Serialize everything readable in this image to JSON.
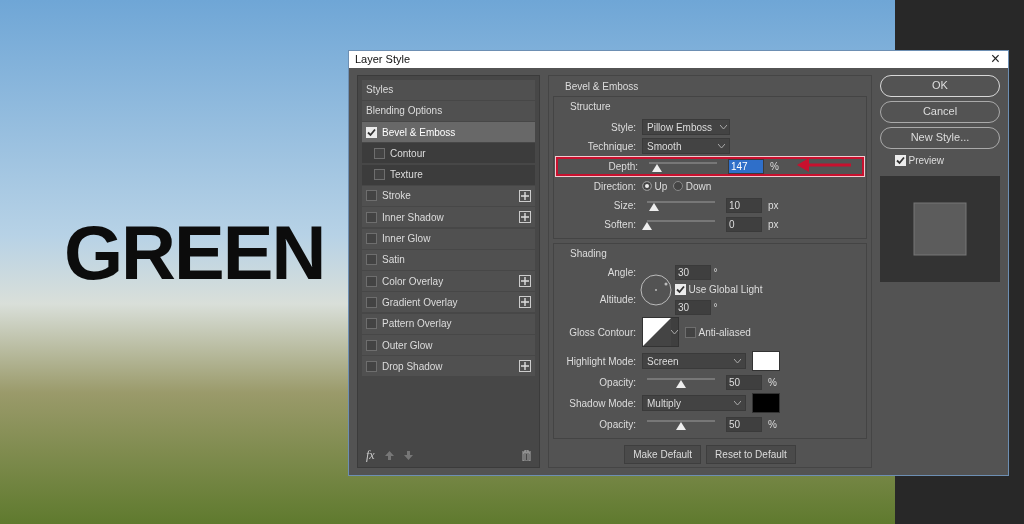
{
  "canvas": {
    "text": "GREEN"
  },
  "window": {
    "title": "Layer Style",
    "close": "×"
  },
  "styles_list": {
    "items": [
      {
        "kind": "header",
        "label": "Styles",
        "selected": false
      },
      {
        "kind": "header",
        "label": "Blending Options",
        "selected": false
      },
      {
        "kind": "effect",
        "label": "Bevel & Emboss",
        "checked": true,
        "selected": true,
        "addable": false,
        "children": [
          {
            "kind": "effect",
            "label": "Contour",
            "checked": false,
            "selected": false,
            "addable": false
          },
          {
            "kind": "effect",
            "label": "Texture",
            "checked": false,
            "selected": false,
            "addable": false
          }
        ]
      },
      {
        "kind": "effect",
        "label": "Stroke",
        "checked": false,
        "selected": false,
        "addable": true
      },
      {
        "kind": "effect",
        "label": "Inner Shadow",
        "checked": false,
        "selected": false,
        "addable": true
      },
      {
        "kind": "effect",
        "label": "Inner Glow",
        "checked": false,
        "selected": false,
        "addable": false
      },
      {
        "kind": "effect",
        "label": "Satin",
        "checked": false,
        "selected": false,
        "addable": false
      },
      {
        "kind": "effect",
        "label": "Color Overlay",
        "checked": false,
        "selected": false,
        "addable": true
      },
      {
        "kind": "effect",
        "label": "Gradient Overlay",
        "checked": false,
        "selected": false,
        "addable": true
      },
      {
        "kind": "effect",
        "label": "Pattern Overlay",
        "checked": false,
        "selected": false,
        "addable": false
      },
      {
        "kind": "effect",
        "label": "Outer Glow",
        "checked": false,
        "selected": false,
        "addable": false
      },
      {
        "kind": "effect",
        "label": "Drop Shadow",
        "checked": false,
        "selected": false,
        "addable": true
      }
    ],
    "fx_label": "fx"
  },
  "panel": {
    "title": "Bevel & Emboss",
    "structure": {
      "title": "Structure",
      "rows": [
        {
          "kind": "select",
          "label": "Style:",
          "value": "Pillow Emboss"
        },
        {
          "kind": "select",
          "label": "Technique:",
          "value": "Smooth"
        },
        {
          "kind": "slider",
          "label": "Depth:",
          "level": 0.12,
          "value": "147",
          "unit": "%",
          "highlighted": true,
          "text_selected": true
        },
        {
          "kind": "radio",
          "label": "Direction:",
          "options": [
            {
              "label": "Up",
              "selected": true
            },
            {
              "label": "Down",
              "selected": false
            }
          ]
        },
        {
          "kind": "slider",
          "label": "Size:",
          "level": 0.1,
          "value": "10",
          "unit": "px",
          "highlighted": false,
          "text_selected": false
        },
        {
          "kind": "slider",
          "label": "Soften:",
          "level": 0,
          "value": "0",
          "unit": "px",
          "highlighted": false,
          "text_selected": false
        }
      ]
    },
    "shading": {
      "title": "Shading",
      "angle": {
        "label": "Angle:",
        "value": "30",
        "unit": "°"
      },
      "global_light": {
        "label": "Use Global Light",
        "checked": true
      },
      "altitude": {
        "label": "Altitude:",
        "value": "30",
        "unit": "°"
      },
      "gloss": {
        "label": "Gloss Contour:",
        "anti_aliased": {
          "label": "Anti-aliased",
          "checked": false
        }
      },
      "rows": [
        {
          "kind": "mode",
          "label": "Highlight Mode:",
          "value": "Screen",
          "color": "#ffffff"
        },
        {
          "kind": "slider",
          "label": "Opacity:",
          "level": 0.5,
          "value": "50",
          "unit": "%",
          "highlighted": false,
          "text_selected": false
        },
        {
          "kind": "mode",
          "label": "Shadow Mode:",
          "value": "Multiply",
          "color": "#000000"
        },
        {
          "kind": "slider",
          "label": "Opacity:",
          "level": 0.5,
          "value": "50",
          "unit": "%",
          "highlighted": false,
          "text_selected": false
        }
      ]
    },
    "buttons": [
      "Make Default",
      "Reset to Default"
    ]
  },
  "actions": {
    "buttons": [
      "OK",
      "Cancel",
      "New Style..."
    ],
    "preview": {
      "label": "Preview",
      "checked": true
    }
  }
}
